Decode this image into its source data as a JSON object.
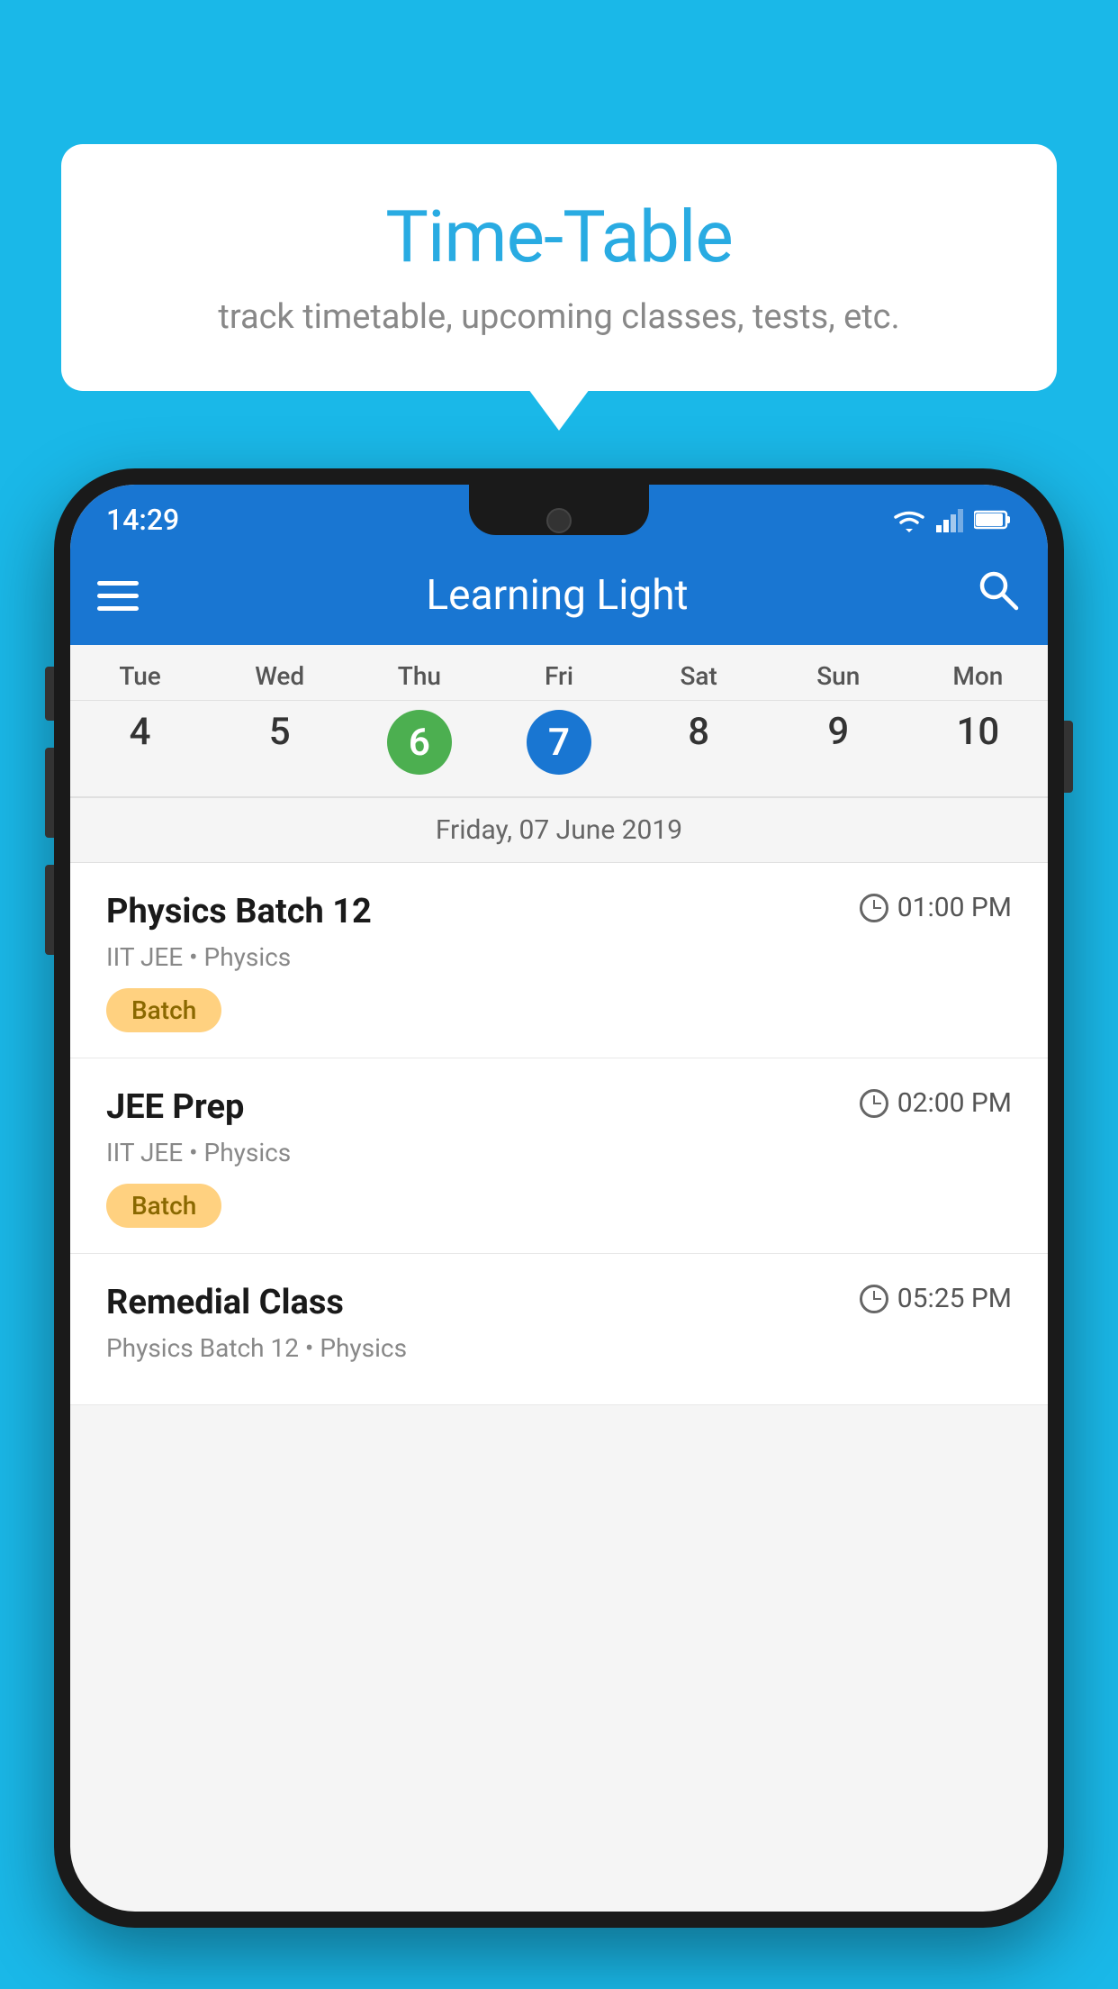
{
  "background_color": "#1ab8e8",
  "tooltip": {
    "title": "Time-Table",
    "subtitle": "track timetable, upcoming classes, tests, etc."
  },
  "phone": {
    "status_bar": {
      "time": "14:29",
      "icons": [
        "wifi",
        "signal",
        "battery"
      ]
    },
    "app_bar": {
      "title": "Learning Light",
      "menu_icon": "hamburger-icon",
      "search_icon": "search-icon"
    },
    "calendar": {
      "days": [
        "Tue",
        "Wed",
        "Thu",
        "Fri",
        "Sat",
        "Sun",
        "Mon"
      ],
      "dates": [
        "4",
        "5",
        "6",
        "7",
        "8",
        "9",
        "10"
      ],
      "today_index": 2,
      "selected_index": 3,
      "selected_date_label": "Friday, 07 June 2019"
    },
    "classes": [
      {
        "name": "Physics Batch 12",
        "time": "01:00 PM",
        "meta": "IIT JEE • Physics",
        "badge": "Batch"
      },
      {
        "name": "JEE Prep",
        "time": "02:00 PM",
        "meta": "IIT JEE • Physics",
        "badge": "Batch"
      },
      {
        "name": "Remedial Class",
        "time": "05:25 PM",
        "meta": "Physics Batch 12 • Physics",
        "badge": null
      }
    ]
  }
}
